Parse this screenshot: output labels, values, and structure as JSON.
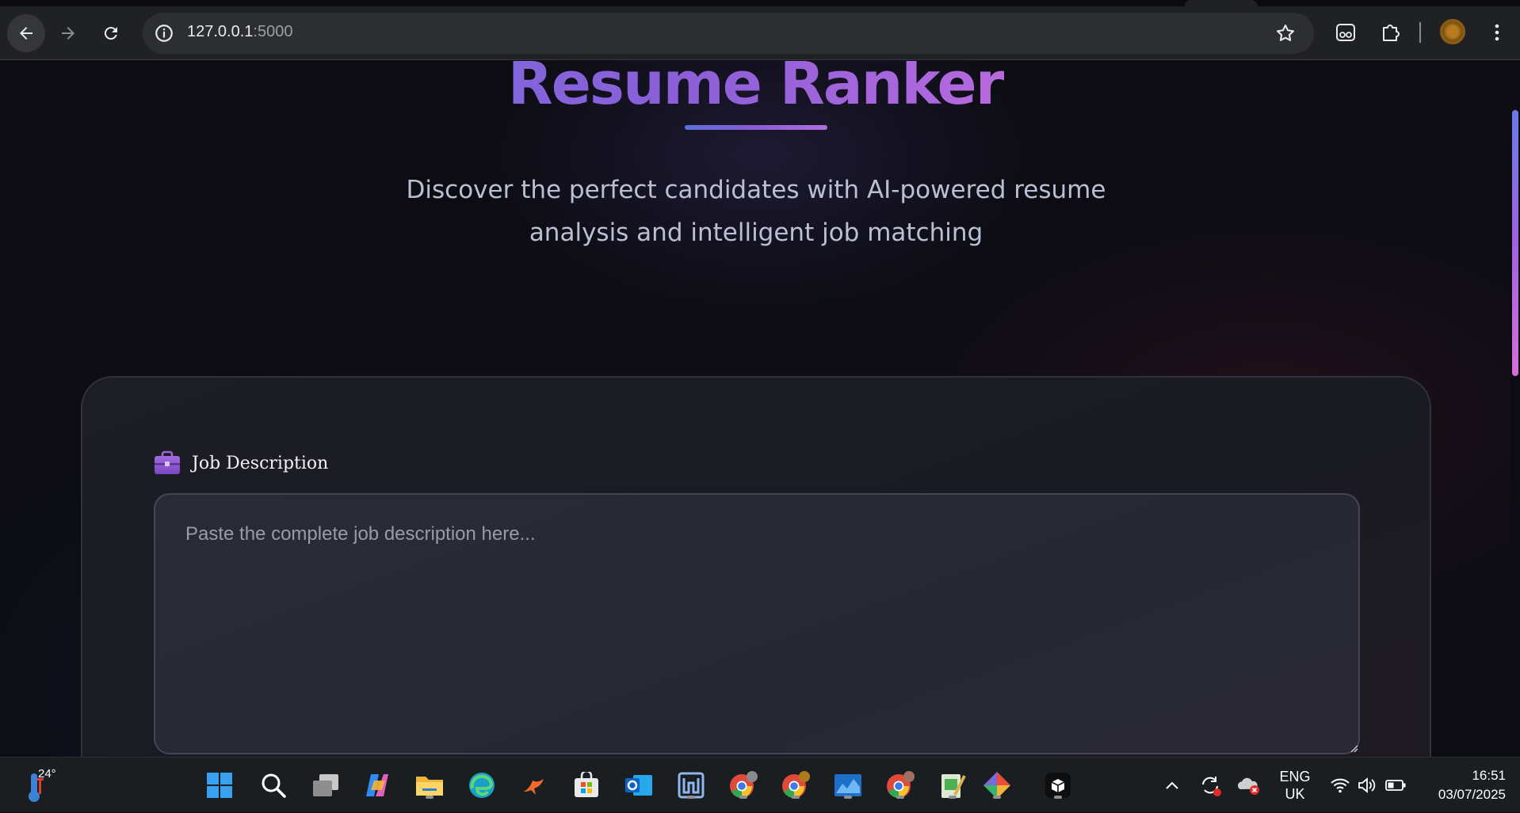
{
  "browser": {
    "url_host": "127.0.0.1",
    "url_port": ":5000"
  },
  "page": {
    "title": "Resume Ranker",
    "subtitle": "Discover the perfect candidates with AI-powered resume analysis and intelligent job matching",
    "job_description": {
      "label": "Job Description",
      "placeholder": "Paste the complete job description here...",
      "value": ""
    }
  },
  "taskbar": {
    "temperature": "24°",
    "language_line1": "ENG",
    "language_line2": "UK",
    "time": "16:51",
    "date": "03/07/2025"
  },
  "colors": {
    "title_gradient_start": "#6b78e8",
    "title_gradient_end": "#e58fe6",
    "card_background": "#1d1d26",
    "page_background": "#0c0c12"
  }
}
